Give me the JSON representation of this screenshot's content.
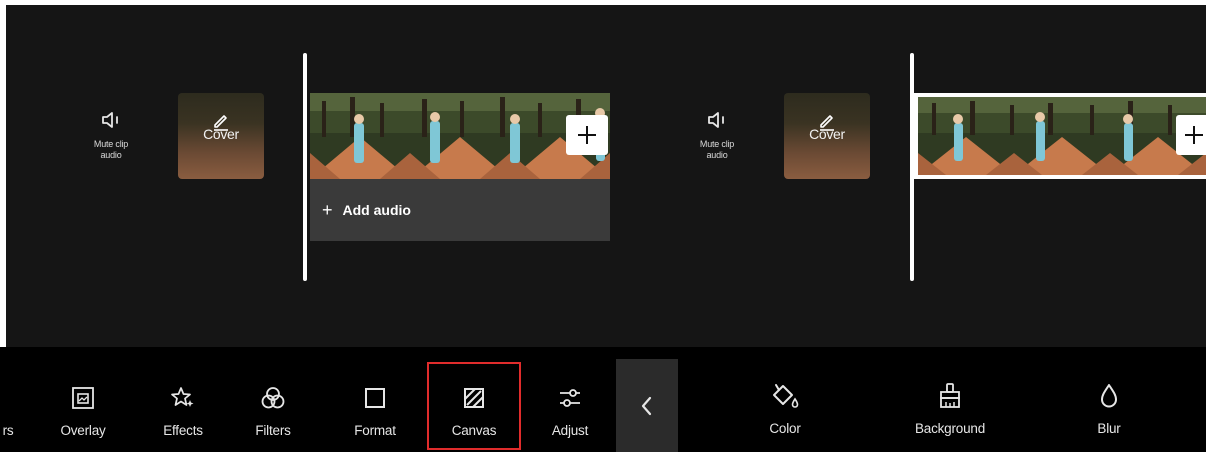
{
  "left_panel": {
    "mute_label_line1": "Mute clip",
    "mute_label_line2": "audio",
    "cover_label": "Cover",
    "add_audio_label": "Add audio"
  },
  "right_panel": {
    "mute_label_line1": "Mute clip",
    "mute_label_line2": "audio",
    "cover_label": "Cover"
  },
  "toolbar": {
    "partial_label": "rs",
    "items": [
      {
        "label": "Overlay",
        "icon": "overlay-icon"
      },
      {
        "label": "Effects",
        "icon": "effects-icon"
      },
      {
        "label": "Filters",
        "icon": "filters-icon"
      },
      {
        "label": "Format",
        "icon": "format-icon"
      },
      {
        "label": "Canvas",
        "icon": "canvas-icon",
        "highlighted": true
      },
      {
        "label": "Adjust",
        "icon": "adjust-icon"
      }
    ],
    "canvas_options": [
      {
        "label": "Color",
        "icon": "paint-bucket-icon"
      },
      {
        "label": "Background",
        "icon": "brush-icon"
      },
      {
        "label": "Blur",
        "icon": "droplet-icon"
      }
    ]
  },
  "colors": {
    "timeline_bg": "#151515",
    "toolbar_bg": "#000000",
    "highlight": "#e12c2c",
    "audio_row": "#3a3a3a"
  }
}
